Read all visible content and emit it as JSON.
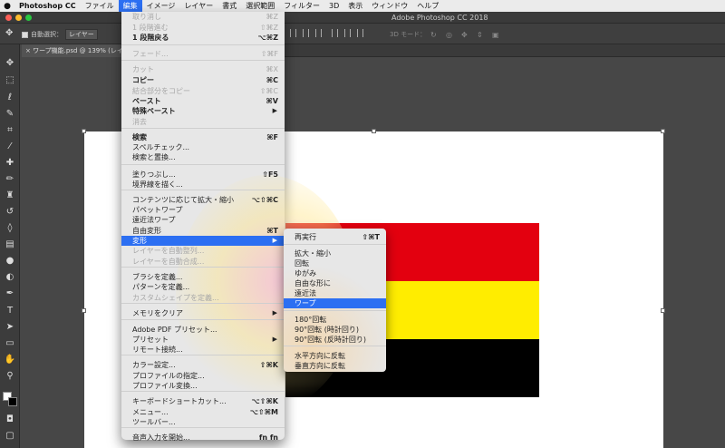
{
  "menubar": {
    "items": [
      "Photoshop CC",
      "ファイル",
      "編集",
      "イメージ",
      "レイヤー",
      "書式",
      "選択範囲",
      "フィルター",
      "3D",
      "表示",
      "ウィンドウ",
      "ヘルプ"
    ]
  },
  "window": {
    "title": "Adobe Photoshop CC 2018"
  },
  "options": {
    "auto_select_label": "自動選択：",
    "auto_select_value": "レイヤー",
    "mode3d": "3D モード："
  },
  "document": {
    "tab": "ワープ機能.psd @ 139% (レイヤ"
  },
  "flag_colors": {
    "top": "#e3000f",
    "middle": "#ffed00",
    "bottom": "#000000"
  },
  "edit_menu": [
    {
      "label": "取り消し",
      "shortcut": "⌘Z",
      "disabled": true
    },
    {
      "label": "1 段階進む",
      "shortcut": "⇧⌘Z",
      "disabled": true
    },
    {
      "label": "1 段階戻る",
      "shortcut": "⌥⌘Z",
      "bold": true
    },
    {
      "label": "フェード...",
      "shortcut": "⇧⌘F",
      "disabled": true
    },
    {
      "label": "カット",
      "shortcut": "⌘X",
      "disabled": true
    },
    {
      "label": "コピー",
      "shortcut": "⌘C",
      "bold": true
    },
    {
      "label": "結合部分をコピー",
      "shortcut": "⇧⌘C",
      "disabled": true
    },
    {
      "label": "ペースト",
      "shortcut": "⌘V",
      "bold": true
    },
    {
      "label": "特殊ペースト",
      "shortcut": "▶",
      "bold": true
    },
    {
      "label": "消去",
      "shortcut": "",
      "disabled": true
    },
    {
      "label": "検索",
      "shortcut": "⌘F",
      "bold": true
    },
    {
      "label": "スペルチェック...",
      "shortcut": ""
    },
    {
      "label": "検索と置換...",
      "shortcut": ""
    },
    {
      "label": "塗りつぶし...",
      "shortcut": "⇧F5"
    },
    {
      "label": "境界線を描く...",
      "shortcut": ""
    },
    {
      "label": "コンテンツに応じて拡大・縮小",
      "shortcut": "⌥⇧⌘C"
    },
    {
      "label": "パペットワープ",
      "shortcut": ""
    },
    {
      "label": "遠近法ワープ",
      "shortcut": ""
    },
    {
      "label": "自由変形",
      "shortcut": "⌘T"
    },
    {
      "label": "変形",
      "shortcut": "▶",
      "highlight": true
    },
    {
      "label": "レイヤーを自動整列...",
      "shortcut": "",
      "disabled": true
    },
    {
      "label": "レイヤーを自動合成...",
      "shortcut": "",
      "disabled": true
    },
    {
      "label": "ブラシを定義...",
      "shortcut": ""
    },
    {
      "label": "パターンを定義...",
      "shortcut": ""
    },
    {
      "label": "カスタムシェイプを定義...",
      "shortcut": "",
      "disabled": true
    },
    {
      "label": "メモリをクリア",
      "shortcut": "▶"
    },
    {
      "label": "Adobe PDF プリセット...",
      "shortcut": ""
    },
    {
      "label": "プリセット",
      "shortcut": "▶"
    },
    {
      "label": "リモート接続...",
      "shortcut": ""
    },
    {
      "label": "カラー設定...",
      "shortcut": "⇧⌘K"
    },
    {
      "label": "プロファイルの指定...",
      "shortcut": ""
    },
    {
      "label": "プロファイル変換...",
      "shortcut": ""
    },
    {
      "label": "キーボードショートカット...",
      "shortcut": "⌥⇧⌘K"
    },
    {
      "label": "メニュー...",
      "shortcut": "⌥⇧⌘M"
    },
    {
      "label": "ツールバー...",
      "shortcut": ""
    },
    {
      "label": "音声入力を開始...",
      "shortcut": "fn fn"
    }
  ],
  "transform_submenu": [
    {
      "label": "再実行",
      "shortcut": "⇧⌘T"
    },
    {
      "label": "拡大・縮小",
      "shortcut": ""
    },
    {
      "label": "回転",
      "shortcut": ""
    },
    {
      "label": "ゆがみ",
      "shortcut": ""
    },
    {
      "label": "自由な形に",
      "shortcut": ""
    },
    {
      "label": "遠近法",
      "shortcut": ""
    },
    {
      "label": "ワープ",
      "shortcut": "",
      "highlight": true
    },
    {
      "label": "180°回転",
      "shortcut": ""
    },
    {
      "label": "90°回転 (時計回り)",
      "shortcut": ""
    },
    {
      "label": "90°回転 (反時計回り)",
      "shortcut": ""
    },
    {
      "label": "水平方向に反転",
      "shortcut": ""
    },
    {
      "label": "垂直方向に反転",
      "shortcut": ""
    }
  ],
  "tool_icons": [
    "move-icon",
    "marquee-icon",
    "lasso-icon",
    "quick-select-icon",
    "crop-icon",
    "eyedropper-icon",
    "healing-icon",
    "brush-icon",
    "stamp-icon",
    "history-brush-icon",
    "eraser-icon",
    "gradient-icon",
    "blur-icon",
    "dodge-icon",
    "pen-icon",
    "type-icon",
    "path-select-icon",
    "shape-icon",
    "hand-icon",
    "zoom-icon"
  ]
}
